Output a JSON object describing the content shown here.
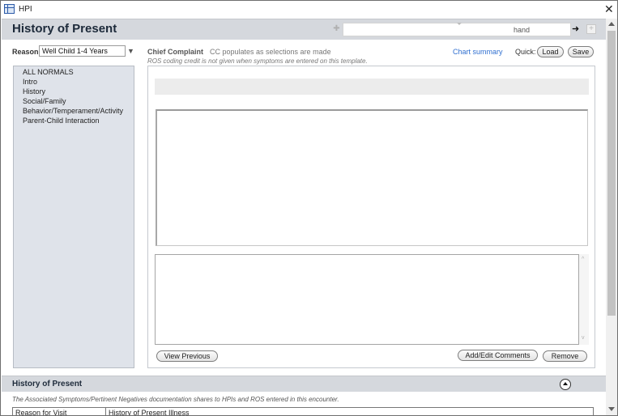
{
  "window": {
    "title": "HPI",
    "close_glyph": "✕"
  },
  "header": {
    "title": "History of Present",
    "nav_value": "hand",
    "prev_glyph": "✚",
    "next_glyph": "➜",
    "add_glyph": "+"
  },
  "reason": {
    "label": "Reason:",
    "value": "Well Child 1-4 Years",
    "caret": "▼"
  },
  "chief_complaint": {
    "label": "Chief Complaint",
    "hint": "CC populates as selections are made",
    "ros_note": "ROS coding credit is not given when symptoms are entered on this template."
  },
  "toolbar": {
    "chart_summary": "Chart summary",
    "quick_label": "Quick:",
    "load_label": "Load",
    "save_label": "Save"
  },
  "sidebar": {
    "items": [
      {
        "label": "ALL NORMALS"
      },
      {
        "label": "Intro"
      },
      {
        "label": "History"
      },
      {
        "label": "Social/Family"
      },
      {
        "label": "Behavior/Temperament/Activity"
      },
      {
        "label": "Parent-Child Interaction"
      }
    ]
  },
  "main": {
    "view_previous_label": "View Previous",
    "add_edit_label": "Add/Edit Comments",
    "remove_label": "Remove",
    "scroll_up_glyph": "^",
    "scroll_down_glyph": "v"
  },
  "bottom": {
    "title": "History of Present",
    "note": "The Associated Symptoms/Pertinent Negatives documentation shares to HPIs and ROS entered in this encounter.",
    "columns": [
      "Reason for Visit",
      "History of Present Illness"
    ]
  }
}
